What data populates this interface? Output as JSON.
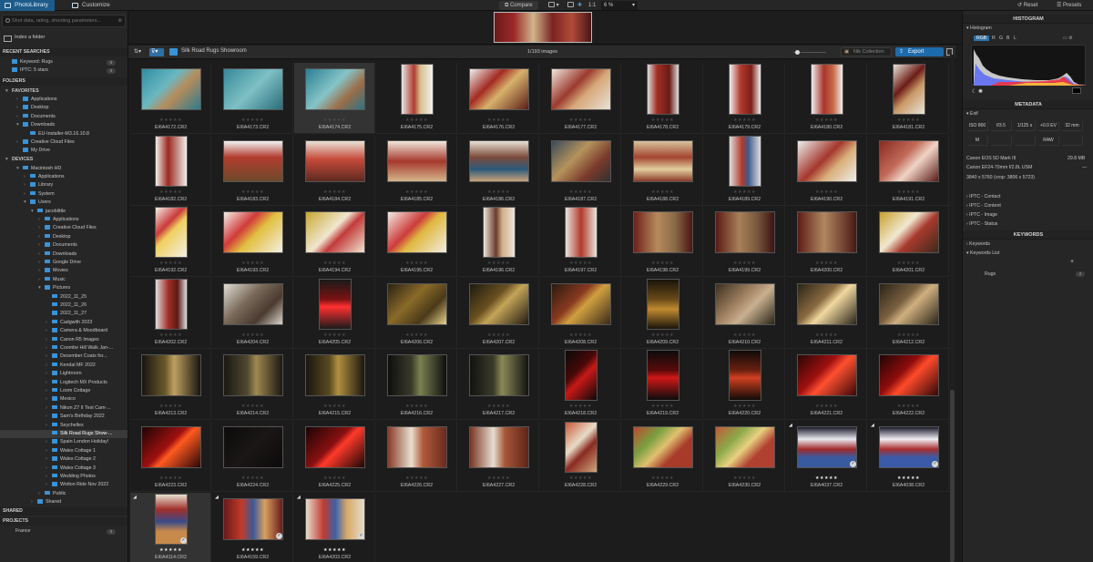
{
  "topbar": {
    "tab_library": "PhotoLibrary",
    "tab_customize": "Customize",
    "compare": "Compare",
    "zoom_ratio": "1:1",
    "zoom_value": "6 %",
    "reset": "Reset",
    "presets": "Presets"
  },
  "left": {
    "search_placeholder": "Shot data, rating, shooting parameters...",
    "index_folder": "Index a folder",
    "recent_title": "RECENT SEARCHES",
    "recent": [
      {
        "label": "Keyword: Rugs",
        "count": "0"
      },
      {
        "label": "IPTC: 5 stars",
        "count": "0"
      }
    ],
    "folders_title": "FOLDERS",
    "favorites_title": "FAVORITES",
    "favorites": [
      "Applications",
      "Desktop",
      "Documents",
      "Downloads",
      "EU-Installer-M3.16.10.8",
      "Creative Cloud Files",
      "My Drive"
    ],
    "devices_title": "DEVICES",
    "devices": [
      "Macintosh HD",
      "Applications",
      "Library",
      "System",
      "Users",
      "jacoblittle",
      "Applications",
      "Creative Cloud Files",
      "Desktop",
      "Documents",
      "Downloads",
      "Google Drive",
      "Movies",
      "Music",
      "Pictures",
      "2022_11_25",
      "2022_11_26",
      "2022_11_27",
      "Cadgwith 2023",
      "Camera & Moodboard",
      "Canon R5 Images",
      "Coombe Hill Walk Jan-...",
      "December Coats for...",
      "Kendal MF 2022",
      "Lightroom",
      "Logitech MX Products",
      "Loom Cottage",
      "Mexico",
      "Nikon Z7 II Test Cam-...",
      "Sam's Birthday 2022",
      "Seychelles",
      "Silk Road Rugs Show-...",
      "Spain London Holiday!",
      "Wales Cottage 1",
      "Wales Cottage 2",
      "Wales Cottage 3",
      "Wedding Photos",
      "Wotton Ride Nov 2022",
      "Public",
      "Shared"
    ],
    "shared_title": "SHARED",
    "projects_title": "PROJECTS",
    "projects": [
      {
        "label": "France",
        "count": "0"
      }
    ]
  },
  "content": {
    "folder_name": "Silk Road Rugs Showroom",
    "count": "1/193 images",
    "nik": "Nik Collection",
    "export": "Export"
  },
  "grid": [
    {
      "name": "EI6A4172.CR2",
      "stars": 0
    },
    {
      "name": "EI6A4173.CR2",
      "stars": 0
    },
    {
      "name": "EI6A4174.CR2",
      "stars": 0
    },
    {
      "name": "EI6A4175.CR2",
      "stars": 0
    },
    {
      "name": "EI6A4176.CR2",
      "stars": 0
    },
    {
      "name": "EI6A4177.CR2",
      "stars": 0
    },
    {
      "name": "EI6A4178.CR2",
      "stars": 0
    },
    {
      "name": "EI6A4179.CR2",
      "stars": 0
    },
    {
      "name": "EI6A4180.CR2",
      "stars": 0
    },
    {
      "name": "EI6A4181.CR2",
      "stars": 0
    },
    {
      "name": "EI6A4182.CR2",
      "stars": 0
    },
    {
      "name": "EI6A4183.CR2",
      "stars": 0
    },
    {
      "name": "EI6A4184.CR2",
      "stars": 0
    },
    {
      "name": "EI6A4185.CR2",
      "stars": 0
    },
    {
      "name": "EI6A4186.CR2",
      "stars": 0
    },
    {
      "name": "EI6A4187.CR2",
      "stars": 0
    },
    {
      "name": "EI6A4188.CR2",
      "stars": 0
    },
    {
      "name": "EI6A4189.CR2",
      "stars": 0
    },
    {
      "name": "EI6A4190.CR2",
      "stars": 0
    },
    {
      "name": "EI6A4191.CR2",
      "stars": 0
    },
    {
      "name": "EI6A4192.CR2",
      "stars": 0
    },
    {
      "name": "EI6A4193.CR2",
      "stars": 0
    },
    {
      "name": "EI6A4194.CR2",
      "stars": 0
    },
    {
      "name": "EI6A4195.CR2",
      "stars": 0
    },
    {
      "name": "EI6A4196.CR2",
      "stars": 0
    },
    {
      "name": "EI6A4197.CR2",
      "stars": 0
    },
    {
      "name": "EI6A4198.CR2",
      "stars": 0
    },
    {
      "name": "EI6A4199.CR2",
      "stars": 0
    },
    {
      "name": "EI6A4200.CR2",
      "stars": 0
    },
    {
      "name": "EI6A4201.CR2",
      "stars": 0
    },
    {
      "name": "EI6A4202.CR2",
      "stars": 0
    },
    {
      "name": "EI6A4204.CR2",
      "stars": 0
    },
    {
      "name": "EI6A4205.CR2",
      "stars": 0
    },
    {
      "name": "EI6A4206.CR2",
      "stars": 0
    },
    {
      "name": "EI6A4207.CR2",
      "stars": 0
    },
    {
      "name": "EI6A4208.CR2",
      "stars": 0
    },
    {
      "name": "EI6A4209.CR2",
      "stars": 0
    },
    {
      "name": "EI6A4210.CR2",
      "stars": 0
    },
    {
      "name": "EI6A4211.CR2",
      "stars": 0
    },
    {
      "name": "EI6A4212.CR2",
      "stars": 0
    },
    {
      "name": "EI6A4213.CR2",
      "stars": 0
    },
    {
      "name": "EI6A4214.CR2",
      "stars": 0
    },
    {
      "name": "EI6A4215.CR2",
      "stars": 0
    },
    {
      "name": "EI6A4216.CR2",
      "stars": 0
    },
    {
      "name": "EI6A4217.CR2",
      "stars": 0
    },
    {
      "name": "EI6A4218.CR2",
      "stars": 0
    },
    {
      "name": "EI6A4219.CR2",
      "stars": 0
    },
    {
      "name": "EI6A4220.CR2",
      "stars": 0
    },
    {
      "name": "EI6A4221.CR2",
      "stars": 0
    },
    {
      "name": "EI6A4222.CR2",
      "stars": 0
    },
    {
      "name": "EI6A4223.CR2",
      "stars": 0
    },
    {
      "name": "EI6A4224.CR2",
      "stars": 0
    },
    {
      "name": "EI6A4225.CR2",
      "stars": 0
    },
    {
      "name": "EI6A4226.CR2",
      "stars": 0
    },
    {
      "name": "EI6A4227.CR2",
      "stars": 0
    },
    {
      "name": "EI6A4228.CR2",
      "stars": 0
    },
    {
      "name": "EI6A4229.CR2",
      "stars": 0
    },
    {
      "name": "EI6A4230.CR2",
      "stars": 0
    },
    {
      "name": "EI6A4037.CR2",
      "stars": 5
    },
    {
      "name": "EI6A4038.CR2",
      "stars": 5
    },
    {
      "name": "EI6A4114.CR2",
      "stars": 5
    },
    {
      "name": "EI6A4159.CR2",
      "stars": 5
    },
    {
      "name": "EI6A4203.CR2",
      "stars": 5
    }
  ],
  "right": {
    "histogram_title": "HISTOGRAM",
    "histogram_label": "Histogram",
    "channels": [
      "RGB",
      "R",
      "G",
      "B",
      "L"
    ],
    "metadata_title": "METADATA",
    "exif_label": "Exif",
    "exif_row1": [
      "ISO 800",
      "f/3.5",
      "1/125 s",
      "+0.0 EV",
      "32 mm"
    ],
    "exif_row2": [
      "M",
      "",
      "",
      "RAW",
      ""
    ],
    "camera": "Canon EOS 5D Mark III",
    "size": "29.8 MB",
    "lens": "Canon EF24-70mm f/2.8L USM",
    "dimensions": "3840 x 5760 (crop: 3806 x 5723)",
    "iptc": [
      "IPTC - Contact",
      "IPTC - Content",
      "IPTC - Image",
      "IPTC - Status"
    ],
    "keywords_title": "KEYWORDS",
    "keywords_label": "Keywords",
    "keywords_list_label": "Keywords List",
    "keyword": "Rugs",
    "keyword_count": "2"
  }
}
